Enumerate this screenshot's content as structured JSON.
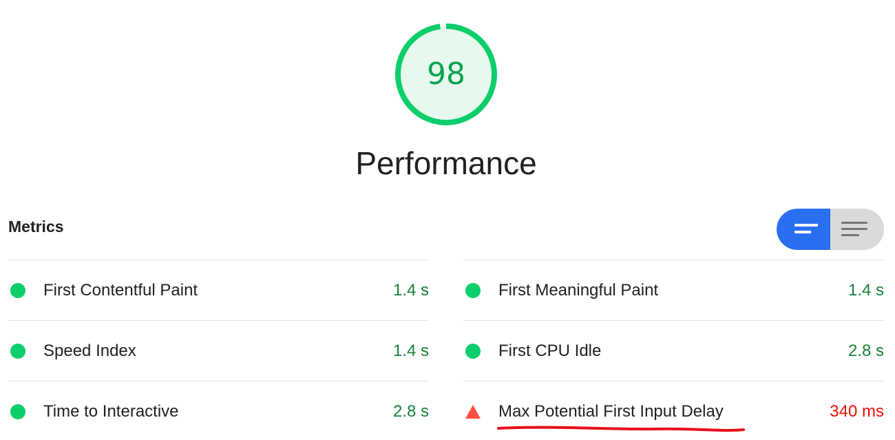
{
  "gauge": {
    "score": "98",
    "score_fraction": 0.98,
    "title": "Performance",
    "color": "#0cce6b",
    "fill": "#e7f8ee"
  },
  "metrics": {
    "header": "Metrics",
    "toggle": {
      "active": "compact",
      "left_icon": "list-compact-icon",
      "right_icon": "list-expanded-icon",
      "active_color": "#2a6ff0"
    },
    "left": [
      {
        "label": "First Contentful Paint",
        "value": "1.4 s",
        "status": "pass"
      },
      {
        "label": "Speed Index",
        "value": "1.4 s",
        "status": "pass"
      },
      {
        "label": "Time to Interactive",
        "value": "2.8 s",
        "status": "pass"
      }
    ],
    "right": [
      {
        "label": "First Meaningful Paint",
        "value": "1.4 s",
        "status": "pass"
      },
      {
        "label": "First CPU Idle",
        "value": "2.8 s",
        "status": "pass"
      },
      {
        "label": "Max Potential First Input Delay",
        "value": "340 ms",
        "status": "fail"
      }
    ],
    "colors": {
      "pass": "#0cce6b",
      "fail": "#ff4e42"
    }
  }
}
